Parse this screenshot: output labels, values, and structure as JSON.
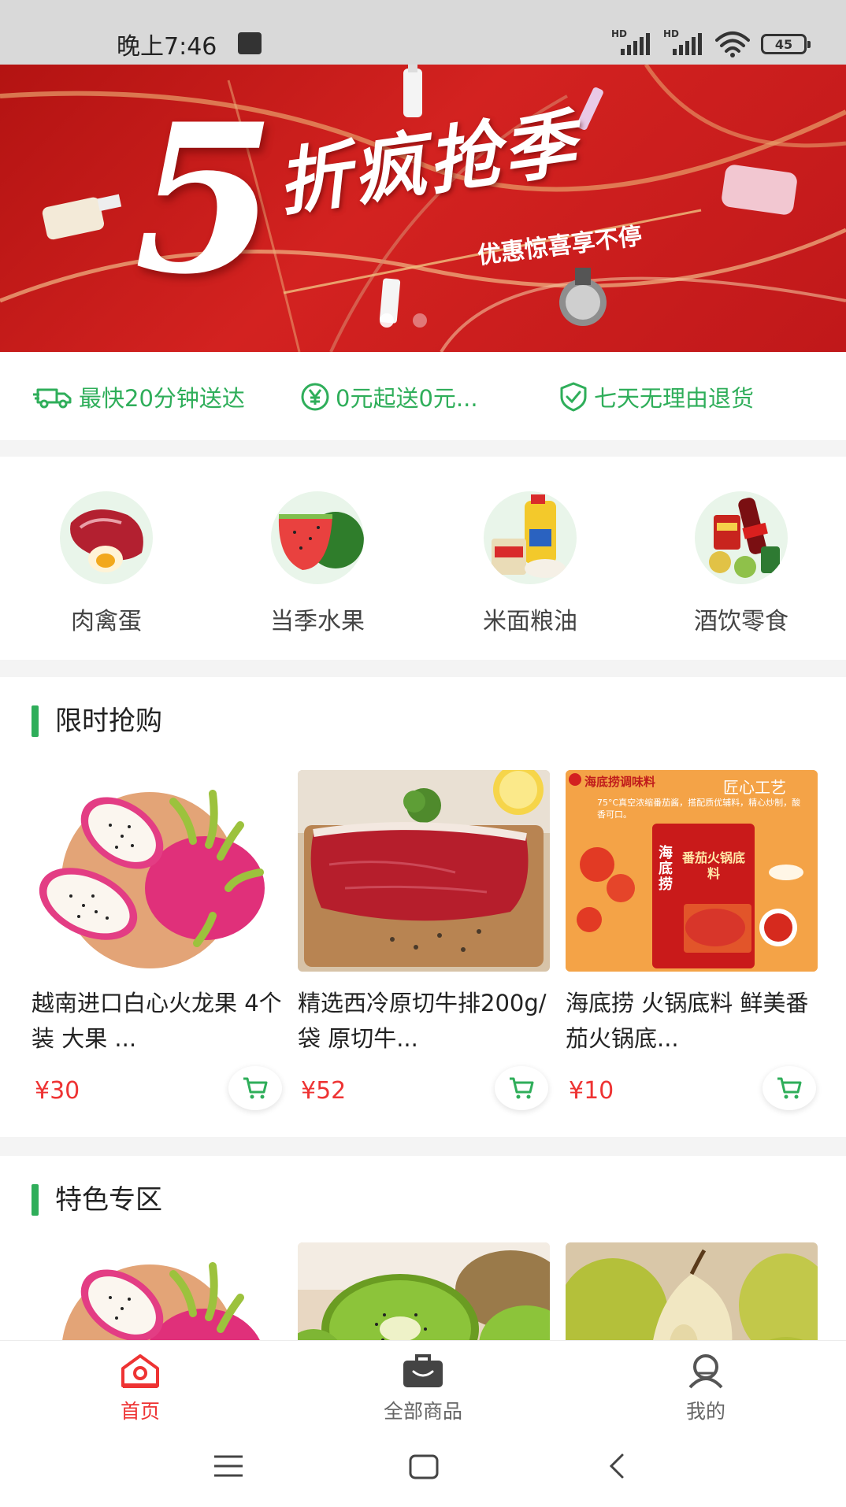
{
  "status_bar": {
    "time": "晚上7:46",
    "battery": "45",
    "signal_label": "HD"
  },
  "banner": {
    "big_letter": "5",
    "title": "折疯抢季",
    "subtitle": "优惠惊喜享不停",
    "slide_count": 2,
    "active_slide": 1
  },
  "services": [
    {
      "icon": "truck-icon",
      "label": "最快20分钟送达"
    },
    {
      "icon": "yen-icon",
      "label": "0元起送0元..."
    },
    {
      "icon": "shield-check-icon",
      "label": "七天无理由退货"
    }
  ],
  "categories": [
    {
      "label": "肉禽蛋",
      "icon": "meat-egg-image"
    },
    {
      "label": "当季水果",
      "icon": "watermelon-image"
    },
    {
      "label": "米面粮油",
      "icon": "grain-oil-image"
    },
    {
      "label": "酒饮零食",
      "icon": "drinks-snacks-image"
    }
  ],
  "flash_sale": {
    "title": "限时抢购",
    "products": [
      {
        "name": "越南进口白心火龙果 4个装 大果 ...",
        "price": "¥30",
        "image": "dragon-fruit-image"
      },
      {
        "name": "精选西冷原切牛排200g/袋 原切牛...",
        "price": "¥52",
        "image": "sirloin-steak-image"
      },
      {
        "name": "海底捞 火锅底料 鲜美番茄火锅底...",
        "price": "¥10",
        "image": "hotpot-base-image",
        "image_text": {
          "brand": "海底捞调味料",
          "tag": "匠心工艺",
          "desc": "75°C真空浓缩番茄酱，搭配质优辅料，精心炒制，酸香可口。",
          "pack_brand": "海底捞",
          "pack_title": "番茄火锅底料"
        }
      }
    ]
  },
  "featured": {
    "title": "特色专区",
    "products": [
      {
        "image": "dragon-fruit-image"
      },
      {
        "image": "kiwi-image"
      },
      {
        "image": "pear-image"
      }
    ]
  },
  "tabbar": [
    {
      "label": "首页",
      "icon": "home-icon",
      "active": true
    },
    {
      "label": "全部商品",
      "icon": "bag-icon",
      "active": false
    },
    {
      "label": "我的",
      "icon": "user-icon",
      "active": false
    }
  ],
  "navbar": [
    "menu-icon",
    "home-square-icon",
    "back-icon"
  ],
  "colors": {
    "accent_green": "#2fae5a",
    "price_red": "#e33333",
    "banner_red": "#c8191a"
  }
}
